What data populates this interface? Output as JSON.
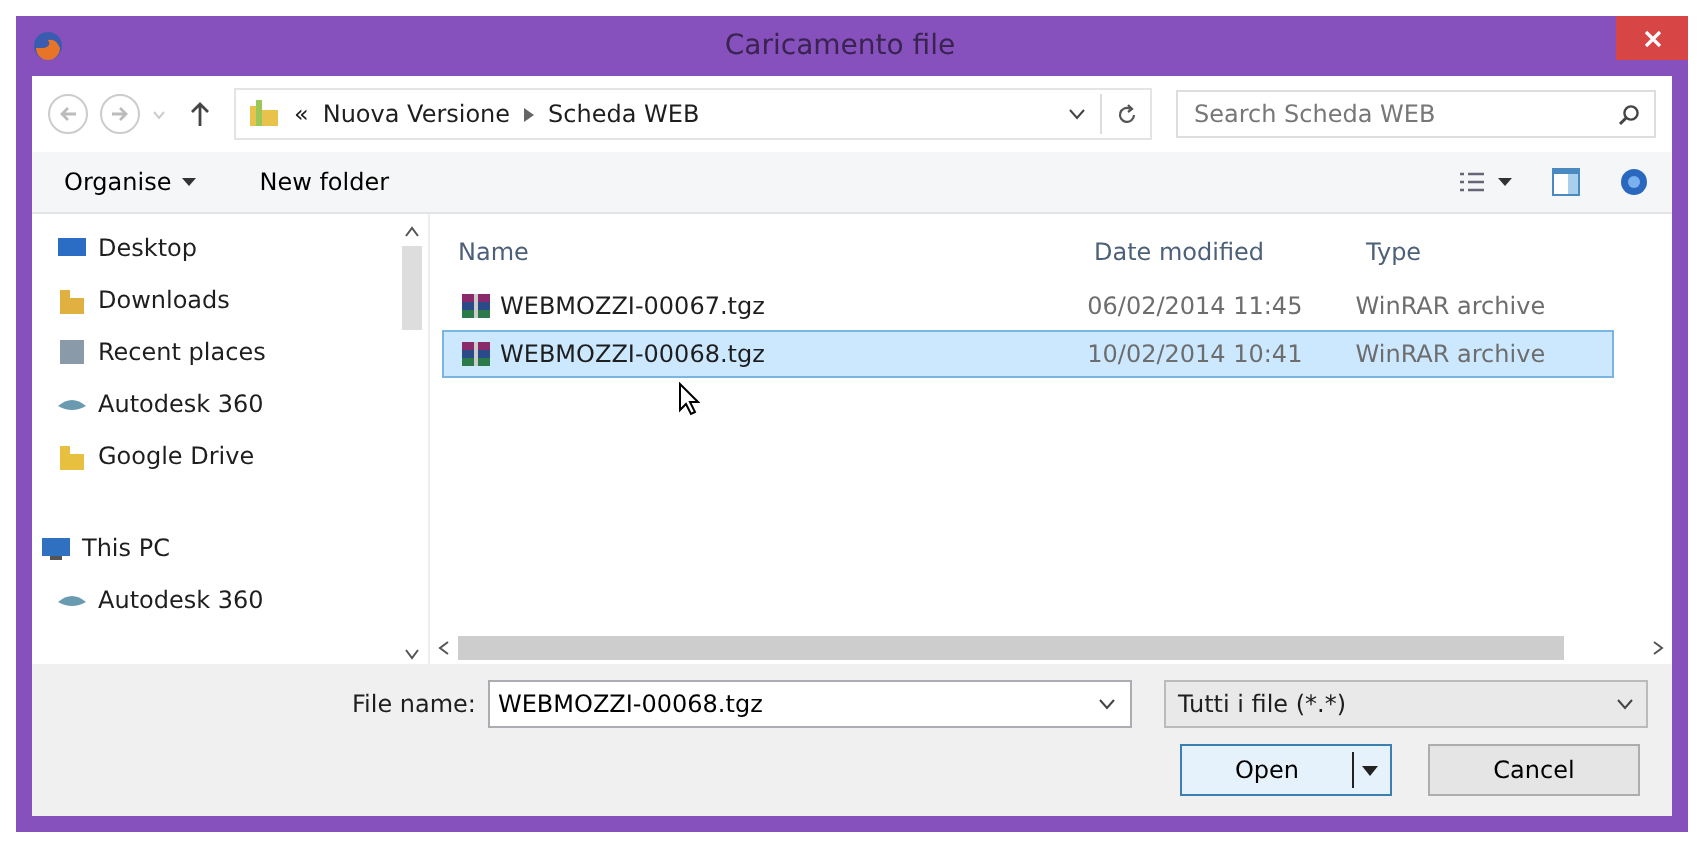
{
  "window": {
    "title": "Caricamento file"
  },
  "address_bar": {
    "path": [
      "«",
      "Nuova Versione",
      "Scheda WEB"
    ]
  },
  "search": {
    "placeholder": "Search Scheda WEB"
  },
  "toolbar": {
    "buttons": [
      "Organise",
      "New folder"
    ]
  },
  "sidebar": {
    "items": [
      {
        "label": "Desktop",
        "kind": "desktop"
      },
      {
        "label": "Downloads",
        "kind": "downloads"
      },
      {
        "label": "Recent places",
        "kind": "recent"
      },
      {
        "label": "Autodesk 360",
        "kind": "cloud"
      },
      {
        "label": "Google Drive",
        "kind": "drive"
      },
      {
        "label": "This PC",
        "kind": "pc",
        "children": [
          {
            "label": "Autodesk 360",
            "kind": "cloud"
          }
        ]
      }
    ]
  },
  "table": {
    "columns": [
      "Name",
      "Date modified",
      "Type"
    ],
    "rows": [
      {
        "name": "WEBMOZZI-00067.tgz",
        "date": "06/02/2014 11:45",
        "type": "WinRAR archive",
        "selected": false
      },
      {
        "name": "WEBMOZZI-00068.tgz",
        "date": "10/02/2014 10:41",
        "type": "WinRAR archive",
        "selected": true
      }
    ]
  },
  "file_name": {
    "label": "File name:",
    "value": "WEBMOZZI-00068.tgz"
  },
  "file_type": {
    "value": "Tutti i file (*.*)"
  },
  "buttons": [
    "Open",
    "Cancel"
  ]
}
